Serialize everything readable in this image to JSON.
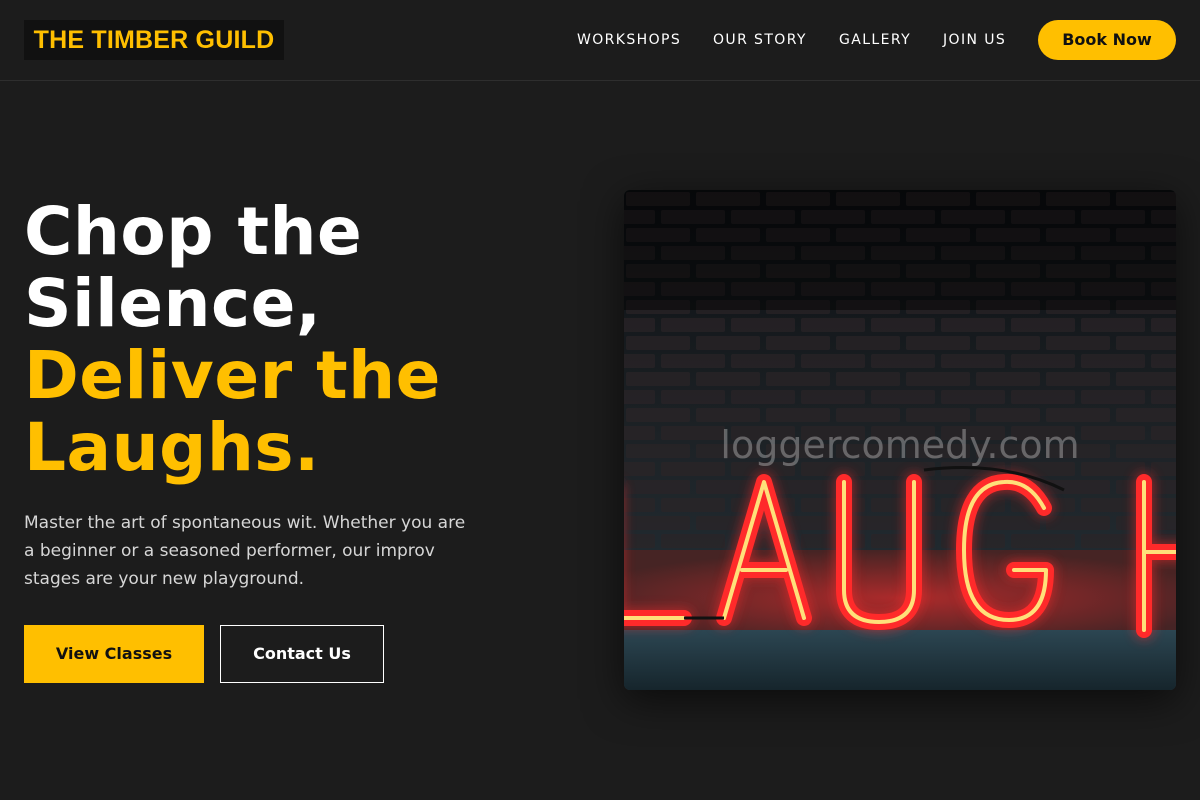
{
  "header": {
    "logo": "THE TIMBER GUILD",
    "nav": [
      "WORKSHOPS",
      "OUR STORY",
      "GALLERY",
      "JOIN US"
    ],
    "cta": "Book Now"
  },
  "hero": {
    "title_lines": [
      "Chop the",
      "Silence,"
    ],
    "title_accent_lines": [
      "Deliver the",
      "Laughs."
    ],
    "description": "Master the art of spontaneous wit. Whether you are a beginner or a seasoned performer, our improv stages are your new playground.",
    "primary_button": "View Classes",
    "secondary_button": "Contact Us"
  },
  "image": {
    "sign_text": "LAUGH",
    "watermark": "loggercomedy.com"
  },
  "colors": {
    "accent": "#ffbf00",
    "background": "#1c1c1c",
    "neon_red": "#ff2a2a",
    "neon_yellow": "#ffe07a"
  }
}
